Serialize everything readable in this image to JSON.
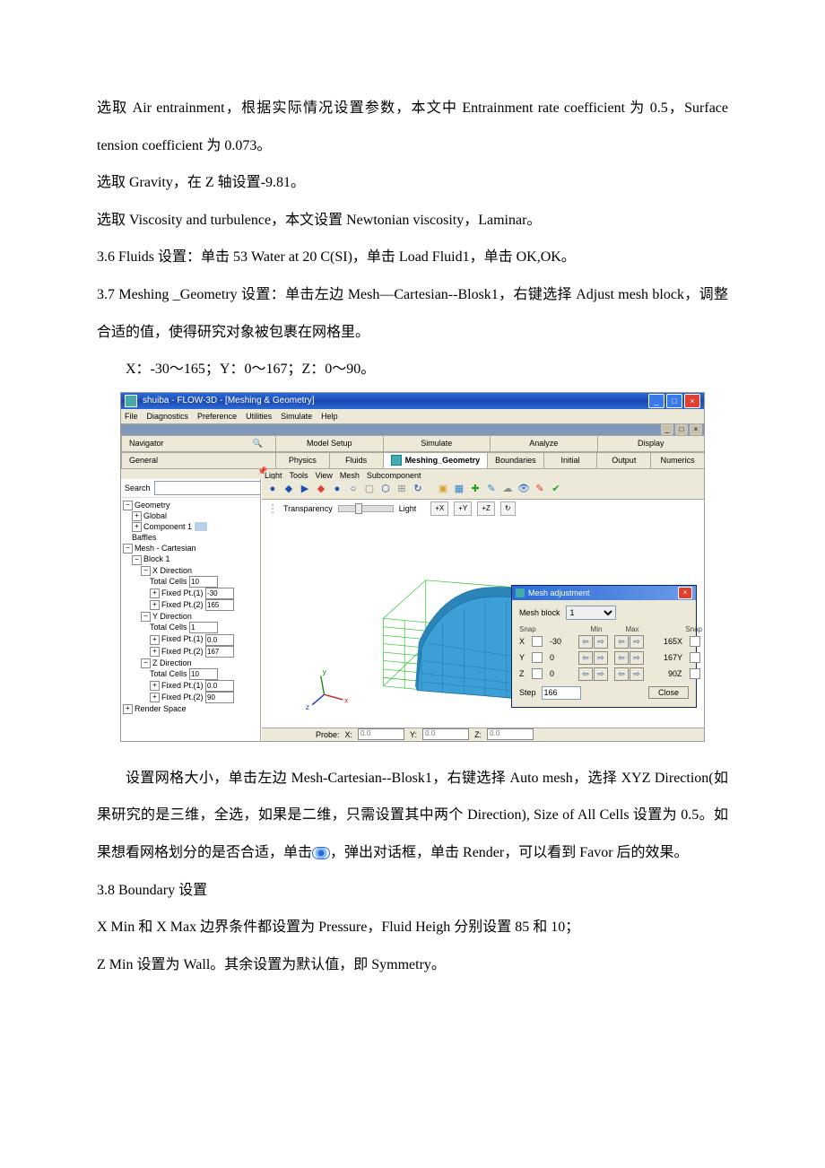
{
  "doc": {
    "p1": "选取 Air entrainment，根据实际情况设置参数，本文中 Entrainment rate coefficient 为 0.5，Surface tension coefficient 为 0.073。",
    "p2": "选取 Gravity，在 Z 轴设置-9.81。",
    "p3": "选取 Viscosity and turbulence，本文设置 Newtonian viscosity，Laminar。",
    "p4": "3.6 Fluids 设置：单击 53 Water at 20 C(SI)，单击 Load Fluid1，单击 OK,OK。",
    "p5": "3.7 Meshing _Geometry 设置：单击左边 Mesh—Cartesian--Blosk1，右键选择 Adjust mesh block，调整合适的值，使得研究对象被包裹在网格里。",
    "p6": "X：-30～165；Y：0～167；Z：0～90。",
    "p7a": "设置网格大小，单击左边 Mesh-Cartesian--Blosk1，右键选择 Auto mesh，选择 XYZ Direction(如果研究的是三维，全选，如果是二维，只需设置其中两个 Direction), Size of All Cells 设置为 0.5。如果想看网格划分的是否合适，单击",
    "p7b": "，弹出对话框，单击 Render，可以看到 Favor 后的效果。",
    "p8": "3.8 Boundary 设置",
    "p9": "X Min 和 X Max 边界条件都设置为 Pressure，Fluid Heigh 分别设置 85 和 10；",
    "p10": "Z Min 设置为 Wall。其余设置为默认值，即 Symmetry。"
  },
  "app": {
    "title": "shuiba - FLOW-3D - [Meshing & Geometry]",
    "menus": [
      "File",
      "Diagnostics",
      "Preference",
      "Utilities",
      "Simulate",
      "Help"
    ],
    "maintabs": [
      "Navigator",
      "Model Setup",
      "Simulate",
      "Analyze",
      "Display"
    ],
    "subtabs": [
      "General",
      "Physics",
      "Fluids",
      "Meshing_Geometry",
      "Boundaries",
      "Initial",
      "Output",
      "Numerics"
    ],
    "activeSubtab": "Meshing_Geometry",
    "submenus": [
      "Light",
      "Tools",
      "View",
      "Mesh",
      "Subcomponent"
    ],
    "search_label": "Search",
    "transparency_label": "Transparency",
    "light_label": "Light",
    "axis_btns": [
      "+X",
      "+Y",
      "+Z"
    ],
    "probe": {
      "label": "Probe:",
      "x": "X:",
      "y": "Y:",
      "z": "Z:",
      "xv": "0.0",
      "yv": "0.0",
      "zv": "0.0"
    }
  },
  "tree": {
    "root1": "Geometry",
    "global": "Global",
    "comp1": "Component 1",
    "baffles": "Baffles",
    "root2": "Mesh - Cartesian",
    "block1": "Block 1",
    "xdir": "X Direction",
    "ydir": "Y Direction",
    "zdir": "Z Direction",
    "total_cells": "Total Cells",
    "fp1": "Fixed Pt.(1)",
    "fp2": "Fixed Pt.(2)",
    "render": "Render Space",
    "x_tc": "10",
    "x_fp1": "-30",
    "x_fp2": "165",
    "y_tc": "1",
    "y_fp1": "0.0",
    "y_fp2": "167",
    "z_tc": "10",
    "z_fp1": "0.0",
    "z_fp2": "90"
  },
  "dlg": {
    "title": "Mesh adjustment",
    "meshblock_label": "Mesh block",
    "meshblock_val": "1",
    "hdr_snap": "Snap",
    "hdr_min": "Min",
    "hdr_max": "Max",
    "rows": [
      {
        "axis": "X",
        "min": "-30",
        "max": "165"
      },
      {
        "axis": "Y",
        "min": "0",
        "max": "167"
      },
      {
        "axis": "Z",
        "min": "0",
        "max": "90"
      }
    ],
    "step_label": "Step",
    "step_val": "166",
    "close": "Close"
  }
}
